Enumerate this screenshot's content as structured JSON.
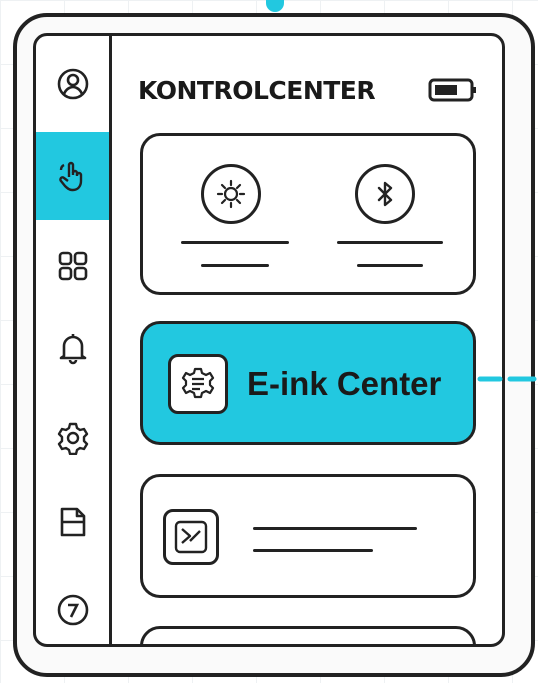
{
  "header": {
    "title": "KONTROLCENTER",
    "battery_icon": "battery-icon"
  },
  "sidebar": {
    "items": [
      {
        "name": "profile",
        "icon": "user-circle-icon",
        "active": false
      },
      {
        "name": "touch",
        "icon": "hand-pointer-icon",
        "active": true
      },
      {
        "name": "apps",
        "icon": "grid-icon",
        "active": false
      },
      {
        "name": "notifications",
        "icon": "bell-icon",
        "active": false
      },
      {
        "name": "settings",
        "icon": "gear-icon",
        "active": false
      },
      {
        "name": "document",
        "icon": "document-icon",
        "active": false
      },
      {
        "name": "help",
        "icon": "help-circle-icon",
        "active": false
      }
    ]
  },
  "quick_toggles": [
    {
      "name": "brightness",
      "icon": "sun-icon"
    },
    {
      "name": "bluetooth",
      "icon": "bluetooth-icon"
    }
  ],
  "eink_center": {
    "label": "E-ink Center",
    "icon": "eink-settings-icon"
  },
  "colors": {
    "accent": "#22c8e0",
    "ink": "#222222",
    "background": "#ffffff"
  }
}
